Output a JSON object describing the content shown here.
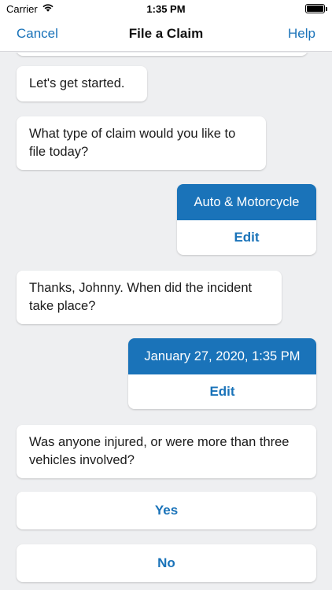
{
  "status_bar": {
    "carrier": "Carrier",
    "time": "1:35 PM",
    "wifi_icon": "wifi-icon",
    "battery_icon": "battery-icon"
  },
  "nav": {
    "cancel_label": "Cancel",
    "title": "File a Claim",
    "help_label": "Help"
  },
  "colors": {
    "accent": "#1a73b9",
    "background": "#eeeff1",
    "bubble": "#ffffff"
  },
  "messages": [
    {
      "from": "bot",
      "text": "Let's get started."
    },
    {
      "from": "bot",
      "text": "What type of claim would you like to file today?"
    },
    {
      "from": "user",
      "text": "Auto & Motorcycle",
      "edit_label": "Edit"
    },
    {
      "from": "bot",
      "text": "Thanks, Johnny. When did the incident take place?"
    },
    {
      "from": "user",
      "text": "January 27, 2020, 1:35 PM",
      "edit_label": "Edit"
    },
    {
      "from": "bot",
      "text": "Was anyone injured, or were more than three vehicles involved?"
    }
  ],
  "options": [
    {
      "label": "Yes"
    },
    {
      "label": "No"
    }
  ]
}
